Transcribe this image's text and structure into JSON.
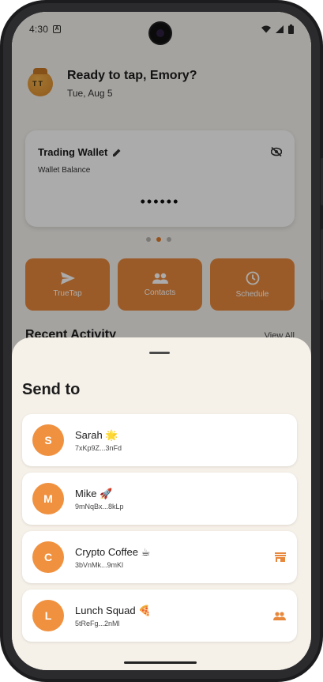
{
  "status_bar": {
    "time": "4:30",
    "notification_icon": "A"
  },
  "header": {
    "greeting": "Ready to tap, Emory?",
    "date": "Tue, Aug 5",
    "mascot_label": "TT"
  },
  "wallet": {
    "title": "Trading Wallet",
    "subtitle": "Wallet Balance",
    "balance_masked": "••••••"
  },
  "carousel": {
    "active_index": 1,
    "count": 3
  },
  "actions": [
    {
      "label": "TrueTap",
      "icon": "send-icon"
    },
    {
      "label": "Contacts",
      "icon": "people-icon"
    },
    {
      "label": "Schedule",
      "icon": "clock-icon"
    }
  ],
  "recent": {
    "title": "Recent Activity",
    "view_all": "View All"
  },
  "sheet": {
    "title": "Send to",
    "contacts": [
      {
        "initial": "S",
        "name": "Sarah 🌟",
        "address": "7xKp9Z...3nFd",
        "badge": ""
      },
      {
        "initial": "M",
        "name": "Mike 🚀",
        "address": "9mNqBx...8kLp",
        "badge": ""
      },
      {
        "initial": "C",
        "name": "Crypto Coffee ☕",
        "address": "3bVnMk...9mKl",
        "badge": "store-icon"
      },
      {
        "initial": "L",
        "name": "Lunch Squad 🍕",
        "address": "5tReFg...2nMl",
        "badge": "group-icon"
      }
    ]
  },
  "colors": {
    "accent": "#e8883c",
    "avatar": "#f0913f",
    "sheet_bg": "#f5f0e8"
  }
}
